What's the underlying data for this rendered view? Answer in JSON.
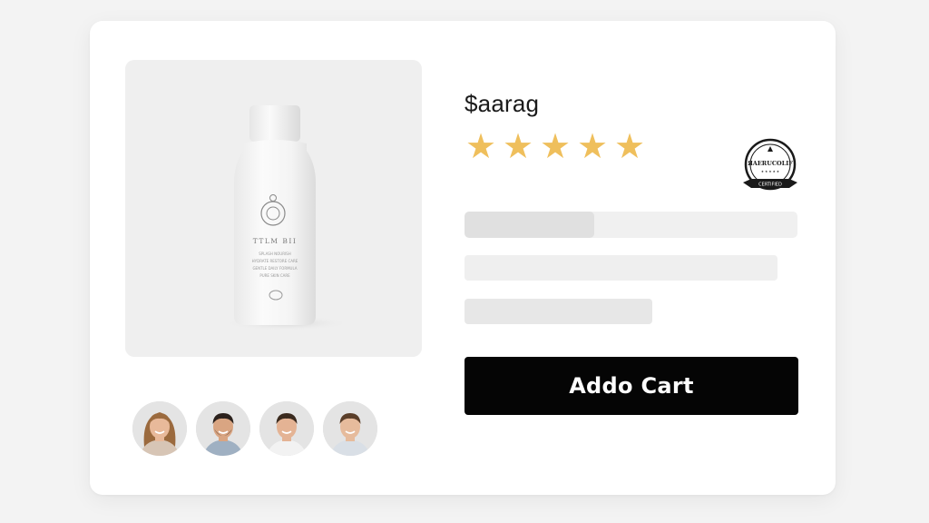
{
  "product": {
    "price": "$aarag",
    "rating_stars": 5,
    "bottle_label": {
      "title": "TTLM BII",
      "line1": "SPLASH NOURISH",
      "line2": "HYDRATE RESTORE CARE",
      "line3": "GENTLE DAILY FORMULA",
      "line4": "PURE SKIN CARE"
    },
    "badge_text": "CERTIFIED",
    "progress_fraction": 0.39
  },
  "actions": {
    "add_to_cart_label": "Addo Cart"
  },
  "colors": {
    "star": "#efbf5c",
    "button_bg": "#050505",
    "button_text": "#ffffff",
    "card_bg": "#ffffff",
    "page_bg": "#f3f3f3"
  },
  "reviewers": [
    {
      "name": "reviewer-1",
      "skin": "#e8b99a",
      "hair": "#9b6a3e"
    },
    {
      "name": "reviewer-2",
      "skin": "#d9a582",
      "hair": "#2b211c"
    },
    {
      "name": "reviewer-3",
      "skin": "#e4b394",
      "hair": "#3a2a1e"
    },
    {
      "name": "reviewer-4",
      "skin": "#e6bb9c",
      "hair": "#5a3e29"
    }
  ]
}
